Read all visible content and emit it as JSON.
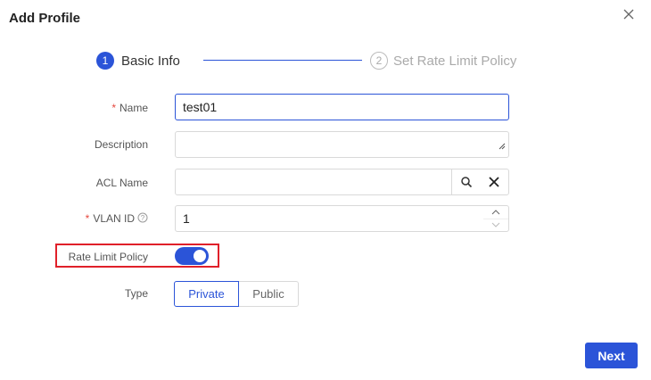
{
  "dialog": {
    "title": "Add Profile"
  },
  "steps": [
    {
      "number": "1",
      "label": "Basic Info",
      "state": "active"
    },
    {
      "number": "2",
      "label": "Set Rate Limit Policy",
      "state": "pending"
    }
  ],
  "form": {
    "name": {
      "label": "Name",
      "required_mark": "*",
      "value": "test01"
    },
    "description": {
      "label": "Description",
      "value": ""
    },
    "acl_name": {
      "label": "ACL Name",
      "value": ""
    },
    "vlan_id": {
      "label": "VLAN ID",
      "required_mark": "*",
      "value": "1"
    },
    "rate_limit_policy": {
      "label": "Rate Limit Policy",
      "enabled": true
    },
    "type": {
      "label": "Type",
      "options": [
        "Private",
        "Public"
      ],
      "selected": "Private"
    }
  },
  "footer": {
    "next_label": "Next"
  },
  "colors": {
    "accent": "#2b54d8",
    "highlight_border": "#e0202a",
    "required": "#e5483e"
  },
  "icons": {
    "close": "close-icon",
    "search": "search-icon",
    "clear": "clear-icon",
    "help": "help-icon",
    "resize": "resize-handle-icon",
    "spin_up": "chevron-up-icon",
    "spin_down": "chevron-down-icon"
  }
}
